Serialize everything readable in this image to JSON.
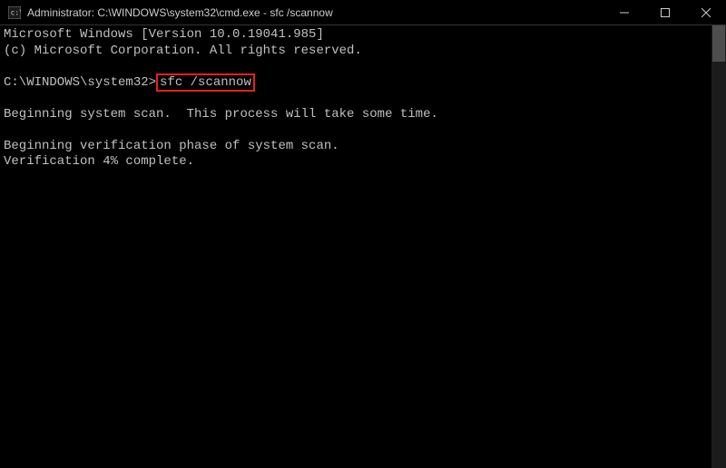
{
  "title_bar": {
    "title": "Administrator: C:\\WINDOWS\\system32\\cmd.exe - sfc  /scannow"
  },
  "terminal": {
    "line1": "Microsoft Windows [Version 10.0.19041.985]",
    "line2": "(c) Microsoft Corporation. All rights reserved.",
    "blank1": "",
    "prompt": "C:\\WINDOWS\\system32>",
    "command": "sfc /scannow",
    "blank2": "",
    "scan_msg": "Beginning system scan.  This process will take some time.",
    "blank3": "",
    "verify_msg": "Beginning verification phase of system scan.",
    "progress_msg": "Verification 4% complete."
  }
}
